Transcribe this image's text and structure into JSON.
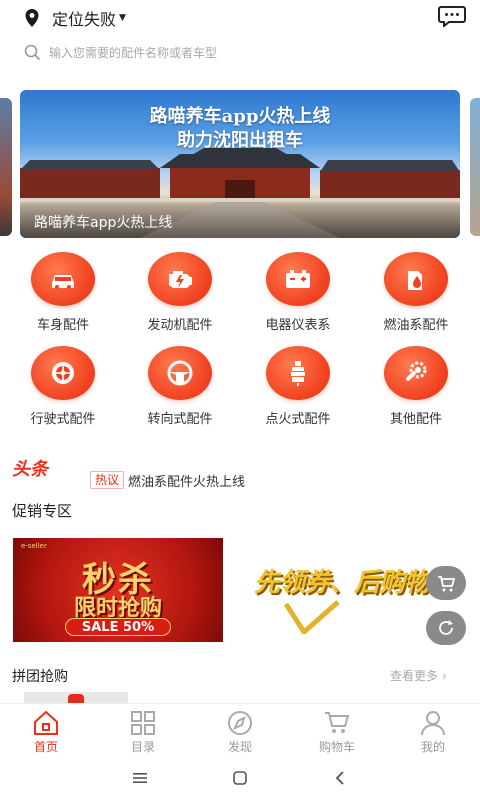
{
  "header": {
    "location": "定位失败",
    "location_icon": "location-pin-icon",
    "message_icon": "chat-bubble-icon"
  },
  "search": {
    "placeholder": "输入您需要的配件名称或者车型"
  },
  "banner": {
    "headline_line1": "路喵养车app火热上线",
    "headline_line2": "助力沈阳出租车",
    "caption": "路喵养车app火热上线"
  },
  "categories": [
    {
      "label": "车身配件",
      "icon": "car-body-icon"
    },
    {
      "label": "发动机配件",
      "icon": "engine-icon"
    },
    {
      "label": "电器仪表系",
      "icon": "battery-icon"
    },
    {
      "label": "燃油系配件",
      "icon": "fuel-icon"
    },
    {
      "label": "行驶式配件",
      "icon": "wheel-icon"
    },
    {
      "label": "转向式配件",
      "icon": "steering-wheel-icon"
    },
    {
      "label": "点火式配件",
      "icon": "spark-plug-icon"
    },
    {
      "label": "其他配件",
      "icon": "wrench-gear-icon"
    }
  ],
  "news": {
    "logo": "头条",
    "tag": "热议",
    "text": "燃油系配件火热上线"
  },
  "promo": {
    "title": "促销专区",
    "card1": {
      "small": "e-seller",
      "big": "秒杀",
      "sub": "限时抢购",
      "sale": "SALE 50%"
    },
    "card2": {
      "text": "先领券、后购物"
    }
  },
  "group_buy": {
    "title": "拼团抢购",
    "more": "查看更多 ›"
  },
  "tabbar": [
    {
      "label": "首页",
      "icon": "home-icon",
      "active": true
    },
    {
      "label": "目录",
      "icon": "grid-icon",
      "active": false
    },
    {
      "label": "发现",
      "icon": "compass-icon",
      "active": false
    },
    {
      "label": "购物车",
      "icon": "cart-icon",
      "active": false
    },
    {
      "label": "我的",
      "icon": "user-icon",
      "active": false
    }
  ],
  "system_nav": [
    "menu-icon",
    "home-square-icon",
    "back-icon"
  ],
  "colors": {
    "accent": "#e8321a",
    "icon_bg": "#f0401f",
    "inactive": "#9a9a9a"
  }
}
